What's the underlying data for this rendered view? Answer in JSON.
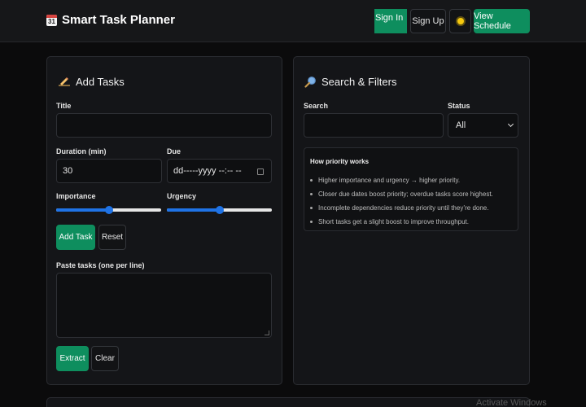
{
  "app": {
    "title": "Smart Task Planner",
    "logo_icon": "calendar-icon",
    "logo_glyph": "31"
  },
  "nav": {
    "sign_in": "Sign In",
    "sign_up": "Sign Up",
    "theme_icon": "sun-icon",
    "view_schedule": "View Schedule"
  },
  "add_tasks": {
    "title": "Add Tasks",
    "title_icon": "writing-hand-icon",
    "title_label": "Title",
    "title_value": "",
    "duration_label": "Duration (min)",
    "duration_value": "30",
    "due_label": "Due",
    "due_value": "dd-----yyyy --:-- --",
    "importance_label": "Importance",
    "importance_value": 0.5,
    "urgency_label": "Urgency",
    "urgency_value": 0.5,
    "add_task": "Add Task",
    "reset": "Reset",
    "paste_label": "Paste tasks (one per line)",
    "paste_value": "",
    "extract": "Extract",
    "clear": "Clear"
  },
  "search_filters": {
    "title": "Search & Filters",
    "title_icon": "magnifier-icon",
    "search_label": "Search",
    "search_value": "",
    "status_label": "Status",
    "status_value": "All",
    "help_title": "How priority works",
    "help_items": [
      "Higher importance and urgency → higher priority.",
      "Closer due dates boost priority; overdue tasks score highest.",
      "Incomplete dependencies reduce priority until they’re done.",
      "Short tasks get a slight boost to improve throughput."
    ]
  },
  "colors": {
    "accent": "#0e8e5e",
    "slider": "#1f73e6",
    "background": "#0b0b0c",
    "card": "#141518"
  },
  "watermark": "Activate Windows"
}
